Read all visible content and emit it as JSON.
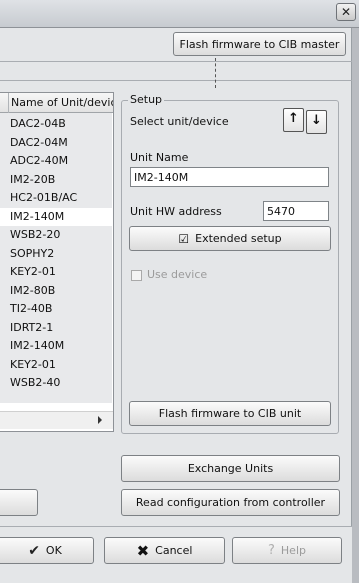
{
  "window": {
    "close_glyph": "✕"
  },
  "toolbar": {
    "flash_master_label": "Flash firmware to CIB master"
  },
  "unit_list": {
    "header": "Name of Unit/device",
    "items": [
      "DAC2-04B",
      "DAC2-04M",
      "ADC2-40M",
      "IM2-20B",
      "HC2-01B/AC",
      "IM2-140M",
      "WSB2-20",
      "SOPHY2",
      "KEY2-01",
      "IM2-80B",
      "TI2-40B",
      "IDRT2-1",
      "IM2-140M",
      "KEY2-01",
      "WSB2-40"
    ],
    "selected_index": 5
  },
  "setup": {
    "group_title": "Setup",
    "select_label": "Select unit/device",
    "up_arrow": "↑",
    "down_arrow": "↓",
    "unit_name_label": "Unit Name",
    "unit_name_value": "IM2-140M",
    "hw_address_label": "Unit HW address",
    "hw_address_value": "5470",
    "extended_setup_label": "Extended setup",
    "use_device_label": "Use device",
    "flash_cib_label": "Flash firmware to  CIB unit"
  },
  "actions": {
    "exchange_label": "Exchange Units",
    "read_config_label": "Read configuration from controller"
  },
  "dialog_buttons": {
    "ok_label": "OK",
    "cancel_label": "Cancel",
    "help_label": "Help"
  },
  "icons": {
    "check_glyph": "✔",
    "cancel_glyph": "✖",
    "help_glyph": "?",
    "extended_glyph": "☑"
  }
}
